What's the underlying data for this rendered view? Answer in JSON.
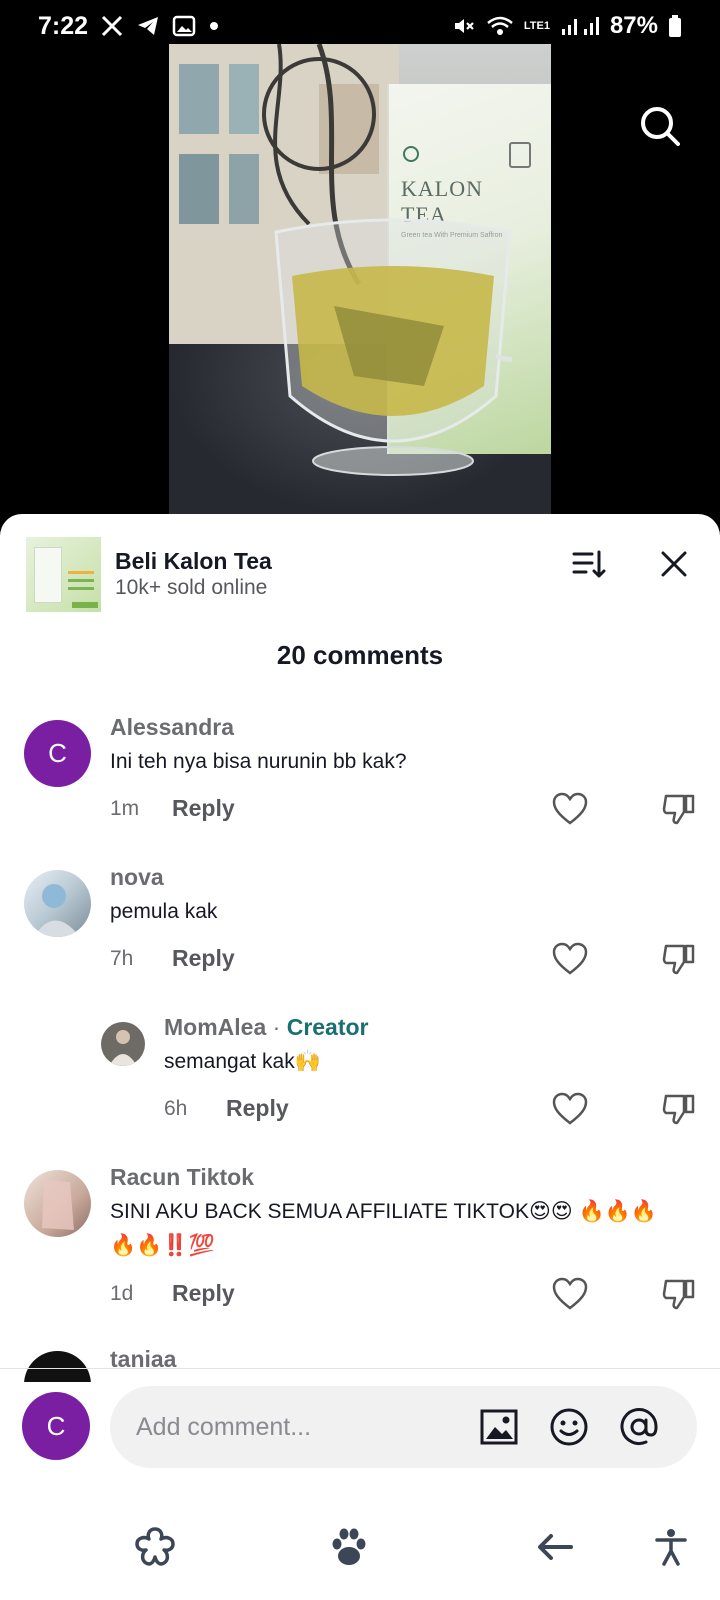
{
  "status_bar": {
    "time": "7:22",
    "battery": "87%",
    "network": "LTE1",
    "icons": [
      "x-icon",
      "telegram-icon",
      "gallery-icon",
      "dot-icon",
      "mute-icon",
      "wifi-icon",
      "signal-icon",
      "battery-icon"
    ]
  },
  "video": {
    "box_brand_line1": "KALON",
    "box_brand_line2": "TEA",
    "box_subtitle": "Green tea With Premium Saffron"
  },
  "product": {
    "title": "Beli Kalon Tea",
    "subtitle": "10k+ sold online"
  },
  "comments_header": "20 comments",
  "comments": [
    {
      "name": "Alessandra",
      "avatar_letter": "C",
      "text": "Ini teh nya bisa nurunin bb kak?",
      "time": "1m",
      "reply": "Reply"
    },
    {
      "name": "nova",
      "text": "pemula kak",
      "time": "7h",
      "reply": "Reply"
    },
    {
      "name": "MomAlea",
      "separator": "·",
      "badge": "Creator",
      "text": "semangat kak🙌",
      "time": "6h",
      "reply": "Reply"
    },
    {
      "name": "Racun Tiktok",
      "text": "SINI AKU BACK SEMUA AFFILIATE TIKTOK😍😍 🔥🔥🔥🔥🔥‼️💯",
      "time": "1d",
      "reply": "Reply"
    },
    {
      "name": "taniaa"
    }
  ],
  "input": {
    "avatar_letter": "C",
    "placeholder": "Add comment..."
  },
  "colors": {
    "accent_avatar": "#7a1fa2",
    "creator": "#1a6f73"
  }
}
